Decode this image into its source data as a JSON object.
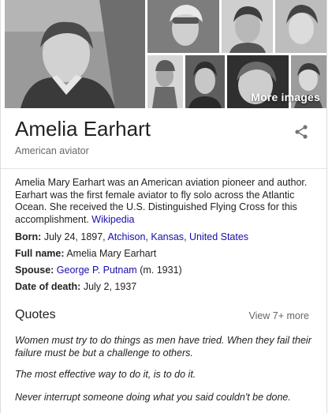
{
  "gallery": {
    "more_label": "More images"
  },
  "panel": {
    "title": "Amelia Earhart",
    "subtitle": "American aviator"
  },
  "description": {
    "text": "Amelia Mary Earhart was an American aviation pioneer and author. Earhart was the first female aviator to fly solo across the Atlantic Ocean. She received the U.S. Distinguished Flying Cross for this accomplishment.",
    "source_link": "Wikipedia"
  },
  "facts": {
    "born": {
      "label": "Born:",
      "date": "July 24, 1897,",
      "place_city": "Atchison",
      "place_state": "Kansas",
      "place_country": "United States"
    },
    "full_name": {
      "label": "Full name:",
      "value": "Amelia Mary Earhart"
    },
    "spouse": {
      "label": "Spouse:",
      "name": "George P. Putnam",
      "detail": "(m. 1931)"
    },
    "death": {
      "label": "Date of death:",
      "value": "July 2, 1937"
    }
  },
  "quotes": {
    "heading": "Quotes",
    "more": "View 7+ more",
    "items": [
      "Women must try to do things as men have tried. When they fail their failure must be but a challenge to others.",
      "The most effective way to do it, is to do it.",
      "Never interrupt someone doing what you said couldn't be done."
    ]
  },
  "icons": {
    "share": "share-icon"
  },
  "colors": {
    "link": "#1a0dab",
    "muted": "#666666",
    "divider": "#e4e4e4"
  }
}
